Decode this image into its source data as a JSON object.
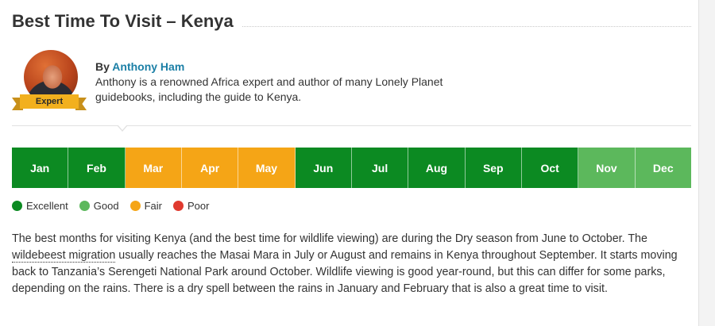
{
  "title": "Best Time To Visit – Kenya",
  "author": {
    "by_prefix": "By ",
    "name": "Anthony Ham",
    "badge": "Expert",
    "bio": "Anthony is a renowned Africa expert and author of many Lonely Planet guidebooks, including the guide to Kenya."
  },
  "colors": {
    "excellent": "#0c8a22",
    "good": "#5cb85c",
    "fair": "#f5a516",
    "poor": "#e03a2f"
  },
  "months": [
    {
      "label": "Jan",
      "rating": "excellent"
    },
    {
      "label": "Feb",
      "rating": "excellent"
    },
    {
      "label": "Mar",
      "rating": "fair"
    },
    {
      "label": "Apr",
      "rating": "fair"
    },
    {
      "label": "May",
      "rating": "fair"
    },
    {
      "label": "Jun",
      "rating": "excellent"
    },
    {
      "label": "Jul",
      "rating": "excellent"
    },
    {
      "label": "Aug",
      "rating": "excellent"
    },
    {
      "label": "Sep",
      "rating": "excellent"
    },
    {
      "label": "Oct",
      "rating": "excellent"
    },
    {
      "label": "Nov",
      "rating": "good"
    },
    {
      "label": "Dec",
      "rating": "good"
    }
  ],
  "legend": [
    {
      "label": "Excellent",
      "rating": "excellent"
    },
    {
      "label": "Good",
      "rating": "good"
    },
    {
      "label": "Fair",
      "rating": "fair"
    },
    {
      "label": "Poor",
      "rating": "poor"
    }
  ],
  "description": {
    "part1": "The best months for visiting Kenya (and the best time for wildlife viewing) are during the Dry season from June to October. The ",
    "link": "wildebeest migration",
    "part2": " usually reaches the Masai Mara in July or August and remains in Kenya throughout September. It starts moving back to Tanzania’s Serengeti National Park around October. Wildlife viewing is good year-round, but this can differ for some parks, depending on the rains. There is a dry spell between the rains in January and February that is also a great time to visit."
  }
}
